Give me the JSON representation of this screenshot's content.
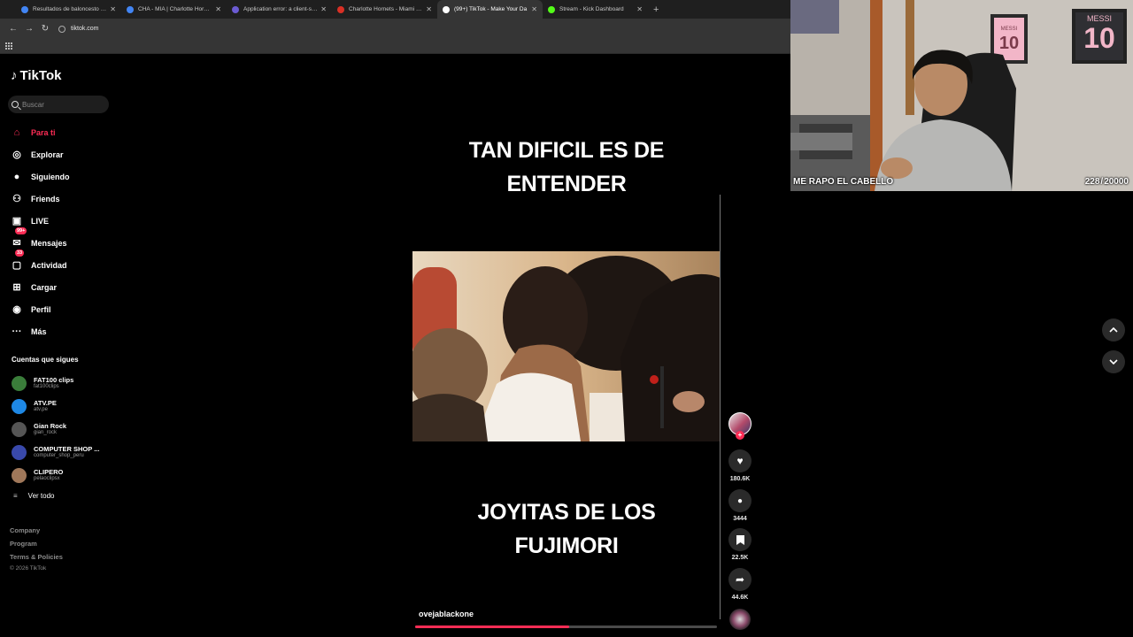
{
  "browser": {
    "tabs": [
      {
        "title": "Resultados de baloncesto en vi",
        "color": "#4285f4",
        "active": false
      },
      {
        "title": "CHA - MIA | Charlotte Hornets",
        "color": "#4285f4",
        "active": false
      },
      {
        "title": "Application error: a client-side",
        "color": "#6b5bd2",
        "active": false
      },
      {
        "title": "Charlotte Hornets - Miami Hea",
        "color": "#d93025",
        "active": false
      },
      {
        "title": "(99+) TikTok - Make Your Da",
        "color": "#ffffff",
        "active": true
      },
      {
        "title": "Stream - Kick Dashboard",
        "color": "#53fc18",
        "active": false
      }
    ],
    "new_tab": "+",
    "url": "tiktok.com"
  },
  "sidebar": {
    "logo": "TikTok",
    "search_placeholder": "Buscar",
    "nav": [
      {
        "label": "Para ti",
        "icon": "home-icon",
        "glyph": "⌂",
        "active": true
      },
      {
        "label": "Explorar",
        "icon": "compass-icon",
        "glyph": "◎",
        "active": false
      },
      {
        "label": "Siguiendo",
        "icon": "following-icon",
        "glyph": "●",
        "active": false
      },
      {
        "label": "Friends",
        "icon": "friends-icon",
        "glyph": "⚇",
        "active": false
      },
      {
        "label": "LIVE",
        "icon": "live-icon",
        "glyph": "▣",
        "active": false
      },
      {
        "label": "Mensajes",
        "icon": "messages-icon",
        "glyph": "✉",
        "active": false,
        "badge": "99+"
      },
      {
        "label": "Actividad",
        "icon": "activity-icon",
        "glyph": "▢",
        "active": false,
        "badge": "33"
      },
      {
        "label": "Cargar",
        "icon": "upload-icon",
        "glyph": "⊞",
        "active": false
      },
      {
        "label": "Perfil",
        "icon": "profile-icon",
        "glyph": "◉",
        "active": false
      },
      {
        "label": "Más",
        "icon": "more-icon",
        "glyph": "···",
        "active": false
      }
    ],
    "following_title": "Cuentas que sigues",
    "following": [
      {
        "name": "FAT100 clips",
        "handle": "fat100clips",
        "color": "#3a7d3a"
      },
      {
        "name": "ATV.PE",
        "handle": "atv.pe",
        "color": "#1e88e5"
      },
      {
        "name": "Gian Rock",
        "handle": "gian_rock",
        "color": "#555555"
      },
      {
        "name": "COMPUTER SHOP ...",
        "handle": "computer_shop_peru",
        "color": "#3949ab"
      },
      {
        "name": "CLIPERO",
        "handle": "pelaoclipsx",
        "color": "#a0785a"
      }
    ],
    "see_all": "Ver todo",
    "footer": [
      "Company",
      "Program",
      "Terms & Policies"
    ],
    "copyright": "© 2026 TikTok"
  },
  "video": {
    "caption_top": [
      "TAN DIFICIL ES DE",
      "ENTENDER"
    ],
    "caption_bottom": [
      "JOYITAS DE LOS",
      "FUJIMORI"
    ],
    "author": "ovejablackone",
    "progress": 0.51,
    "likes": "180.6K",
    "comments": "3444",
    "saves": "22.5K",
    "shares": "44.6K"
  },
  "webcam": {
    "label": "ME RAPO EL CABELLO",
    "count_current": "228",
    "count_sep": "/",
    "count_total": "20000",
    "jersey_name": "MESSI",
    "jersey_number": "10"
  }
}
